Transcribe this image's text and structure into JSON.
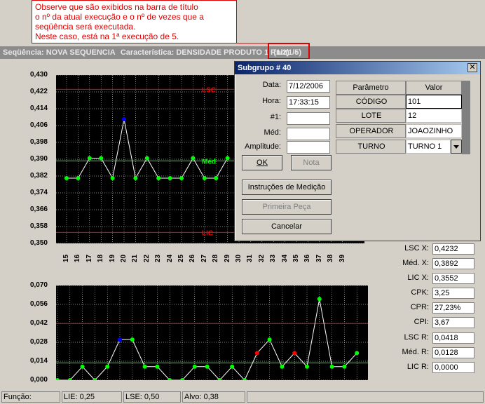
{
  "annotation": {
    "lines": [
      "Observe que são exibidos na barra de título",
      "o nº da atual execução e o nº de vezes que a",
      "seqüência será executada.",
      "Neste caso, está na 1ª execução de 5."
    ]
  },
  "title_bar": {
    "sequence": "Seqüência: NOVA SEQUENCIA",
    "characteristic": "Característica: DENSIDADE PRODUTO 1",
    "page": "(1/2)",
    "separator": "-",
    "run": "Run(1/5)"
  },
  "top_chart": {
    "y_ticks": [
      "0,430",
      "0,422",
      "0,414",
      "0,406",
      "0,398",
      "0,390",
      "0,382",
      "0,374",
      "0,366",
      "0,358",
      "0,350"
    ],
    "x_ticks": [
      "15",
      "16",
      "17",
      "18",
      "19",
      "20",
      "21",
      "22",
      "23",
      "24",
      "25",
      "26",
      "27",
      "28",
      "29",
      "30",
      "31",
      "32",
      "33",
      "34",
      "35",
      "36",
      "37",
      "38",
      "39"
    ],
    "lsc_label": "LSC",
    "med_label": "Méd",
    "lic_label": "LIC"
  },
  "bottom_chart": {
    "y_ticks": [
      "0,070",
      "0,056",
      "0,042",
      "0,028",
      "0,014",
      "0,000"
    ]
  },
  "chart_data": [
    {
      "type": "line",
      "ylim": [
        0.35,
        0.43
      ],
      "x": [
        15,
        16,
        17,
        18,
        19,
        20,
        21,
        22,
        23,
        24,
        25,
        26,
        27,
        28,
        29
      ],
      "values": [
        0.381,
        0.381,
        0.3905,
        0.3905,
        0.381,
        0.409,
        0.381,
        0.3905,
        0.381,
        0.381,
        0.381,
        0.3905,
        0.381,
        0.381,
        0.3905
      ],
      "lsc": 0.4232,
      "med": 0.3892,
      "lic": 0.3552,
      "colors": {
        "line": "#ffffff",
        "point": "#00ff00",
        "highlight": "#0000ff",
        "lsc": "#ff0000",
        "med": "#00ff00",
        "lic": "#ff0000"
      }
    },
    {
      "type": "line",
      "ylim": [
        0,
        0.07
      ],
      "x": [
        15,
        16,
        17,
        18,
        19,
        20,
        21,
        22,
        23,
        24,
        25,
        26,
        27,
        28,
        29,
        30,
        31,
        32,
        33,
        34,
        35,
        36,
        37,
        38,
        39
      ],
      "values": [
        0,
        0,
        0.01,
        0,
        0.01,
        0.03,
        0.03,
        0.01,
        0.01,
        0,
        0,
        0.01,
        0.01,
        0,
        0.01,
        0,
        0.02,
        0.03,
        0.01,
        0.02,
        0.01,
        0.06,
        0.01,
        0.01,
        0.02
      ],
      "lsc": 0.0418,
      "med": 0.0128,
      "lic": 0,
      "colors": {
        "line": "#ffffff",
        "point": "#00ff00",
        "alert": "#ff0000",
        "highlight": "#0000ff",
        "lsc": "#ff0000",
        "med": "#00ff00"
      }
    }
  ],
  "stats": [
    {
      "label": "LSC X:",
      "value": "0,4232"
    },
    {
      "label": "Méd. X:",
      "value": "0,3892"
    },
    {
      "label": "LIC X:",
      "value": "0,3552"
    },
    {
      "label": "CPK:",
      "value": "3,25"
    },
    {
      "label": "CPR:",
      "value": "27,23%"
    },
    {
      "label": "CPI:",
      "value": "3,67"
    },
    {
      "label": "LSC R:",
      "value": "0,0418"
    },
    {
      "label": "Méd. R:",
      "value": "0,0128"
    },
    {
      "label": "LIC R:",
      "value": "0,0000"
    }
  ],
  "dialog": {
    "title": "Subgrupo # 40",
    "close": "✕",
    "fields": [
      {
        "label": "Data:",
        "value": "7/12/2006"
      },
      {
        "label": "Hora:",
        "value": "17:33:15"
      },
      {
        "label": "#1:",
        "value": ""
      },
      {
        "label": "Méd:",
        "value": ""
      },
      {
        "label": "Amplitude:",
        "value": ""
      }
    ],
    "ok_label": "OK",
    "nota_label": "Nota",
    "instrucoes_label": "Instruções de Medição",
    "primeira_label": "Primeira Peça",
    "cancelar_label": "Cancelar",
    "grid": {
      "headers": [
        "Parâmetro",
        "Valor"
      ],
      "rows": [
        {
          "param": "CÓDIGO PRODUTO",
          "value": "101"
        },
        {
          "param": "LOTE",
          "value": "12"
        },
        {
          "param": "OPERADOR",
          "value": "JOAOZINHO"
        },
        {
          "param": "TURNO",
          "value": "TURNO 1"
        }
      ]
    }
  },
  "status_bar": {
    "funcao": "Função:",
    "lie": "LIE: 0,25",
    "lse": "LSE: 0,50",
    "alvo": "Alvo: 0,38"
  }
}
